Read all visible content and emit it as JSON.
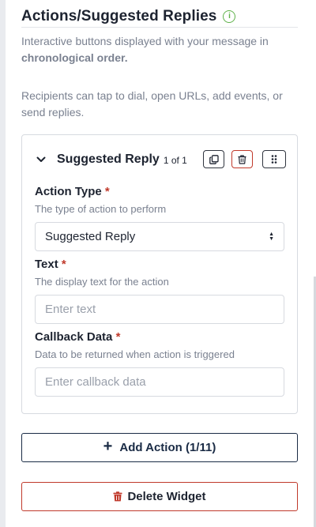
{
  "header": {
    "title": "Actions/Suggested Replies",
    "info_icon": "info-icon",
    "accent_color": "#5fb24a"
  },
  "description": {
    "line1_prefix": "Interactive buttons displayed with your message in ",
    "line1_bold": "chronological order.",
    "line2": "Recipients can tap to dial, open URLs, add events, or send replies."
  },
  "card": {
    "title": "Suggested Reply",
    "count": "1 of 1",
    "tools": [
      "copy-icon",
      "trash-icon",
      "drag-grid-icon"
    ],
    "fields": {
      "action_type": {
        "label": "Action Type",
        "required_mark": "*",
        "help": "The type of action to perform",
        "value": "Suggested Reply"
      },
      "text": {
        "label": "Text",
        "required_mark": "*",
        "help": "The display text for the action",
        "placeholder": "Enter text"
      },
      "callback": {
        "label": "Callback Data",
        "required_mark": "*",
        "help": "Data to be returned when action is triggered",
        "placeholder": "Enter callback data"
      }
    }
  },
  "buttons": {
    "add_action": "Add Action (1/11)",
    "delete_widget": "Delete Widget"
  },
  "colors": {
    "danger": "#c0392b",
    "primary": "#1a2b45"
  }
}
